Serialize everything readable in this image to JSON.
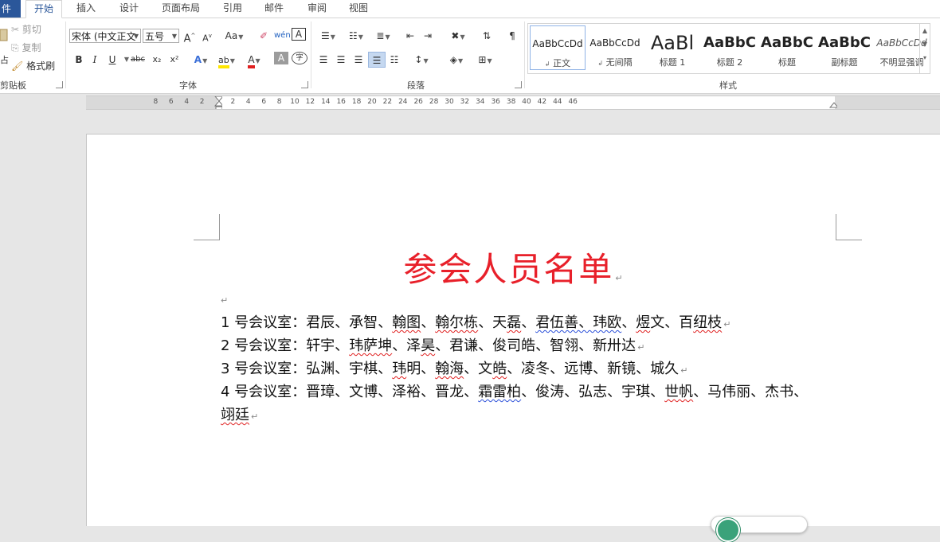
{
  "tabs": {
    "file_label": "件",
    "items": [
      "开始",
      "插入",
      "设计",
      "页面布局",
      "引用",
      "邮件",
      "审阅",
      "视图"
    ]
  },
  "ribbon": {
    "clipboard": {
      "paste_label": "占",
      "cut_label": "剪切",
      "copy_label": "复制",
      "format_painter_label": "格式刷",
      "group_label": "剪贴板"
    },
    "font": {
      "font_name": "宋体 (中文正文",
      "font_size": "五号",
      "grow_label": "A",
      "shrink_label": "A",
      "case_label": "Aa",
      "bold": "B",
      "italic": "I",
      "underline": "U",
      "strike": "abc",
      "subscript": "x₂",
      "superscript": "x²",
      "group_label": "字体"
    },
    "paragraph": {
      "group_label": "段落"
    },
    "styles": {
      "group_label": "样式",
      "items": [
        {
          "sample": "AaBbCcDd",
          "name": "正文",
          "selected": true
        },
        {
          "sample": "AaBbCcDd",
          "name": "无间隔",
          "selected": false
        },
        {
          "sample": "AaBl",
          "name": "标题 1",
          "selected": false
        },
        {
          "sample": "AaBbC",
          "name": "标题 2",
          "selected": false
        },
        {
          "sample": "AaBbC",
          "name": "标题",
          "selected": false
        },
        {
          "sample": "AaBbC",
          "name": "副标题",
          "selected": false
        },
        {
          "sample": "AaBbCcDd",
          "name": "不明显强调",
          "selected": false
        }
      ]
    }
  },
  "ruler": {
    "labels": [
      "8",
      "6",
      "4",
      "2",
      "2",
      "4",
      "6",
      "8",
      "10",
      "12",
      "14",
      "16",
      "18",
      "20",
      "22",
      "24",
      "26",
      "28",
      "30",
      "32",
      "34",
      "36",
      "38",
      "40",
      "42",
      "44",
      "46"
    ]
  },
  "document": {
    "title": "参会人员名单",
    "empty_mark": "↵",
    "lines": [
      {
        "prefix": "1 号会议室：君辰、承智、",
        "segments": [
          {
            "text": "翰图",
            "err": "red"
          },
          {
            "text": "、",
            "err": ""
          },
          {
            "text": "翰尔栋",
            "err": "red"
          },
          {
            "text": "、天",
            "err": ""
          },
          {
            "text": "磊",
            "err": "red"
          },
          {
            "text": "、",
            "err": ""
          },
          {
            "text": "君伍善、玮欧",
            "err": "blue"
          },
          {
            "text": "、",
            "err": ""
          },
          {
            "text": "煜",
            "err": "red"
          },
          {
            "text": "文、百",
            "err": ""
          },
          {
            "text": "纽枝",
            "err": "red"
          }
        ]
      },
      {
        "prefix": "2 号会议室：轩宇、",
        "segments": [
          {
            "text": "玮萨坤",
            "err": "red"
          },
          {
            "text": "、泽",
            "err": ""
          },
          {
            "text": "昊",
            "err": "red"
          },
          {
            "text": "、君谦、俊司皓、智翎、新卅达",
            "err": ""
          }
        ]
      },
      {
        "prefix": "3 号会议室：弘渊、宇棋、",
        "segments": [
          {
            "text": "玮",
            "err": "red"
          },
          {
            "text": "明、",
            "err": ""
          },
          {
            "text": "翰海",
            "err": "red"
          },
          {
            "text": "、文",
            "err": ""
          },
          {
            "text": "皓",
            "err": "red"
          },
          {
            "text": "、凌冬、远博、新镜、城久",
            "err": ""
          }
        ]
      },
      {
        "prefix": "4 号会议室：晋璋、文博、泽裕、晋龙、",
        "segments": [
          {
            "text": "霜雷柏",
            "err": "blue"
          },
          {
            "text": "、俊涛、弘志、宇琪、",
            "err": ""
          },
          {
            "text": "世帆",
            "err": "red"
          },
          {
            "text": "、马伟丽、杰书、",
            "err": ""
          }
        ]
      },
      {
        "prefix": "",
        "segments": [
          {
            "text": "翊廷",
            "err": "red"
          }
        ]
      }
    ]
  }
}
